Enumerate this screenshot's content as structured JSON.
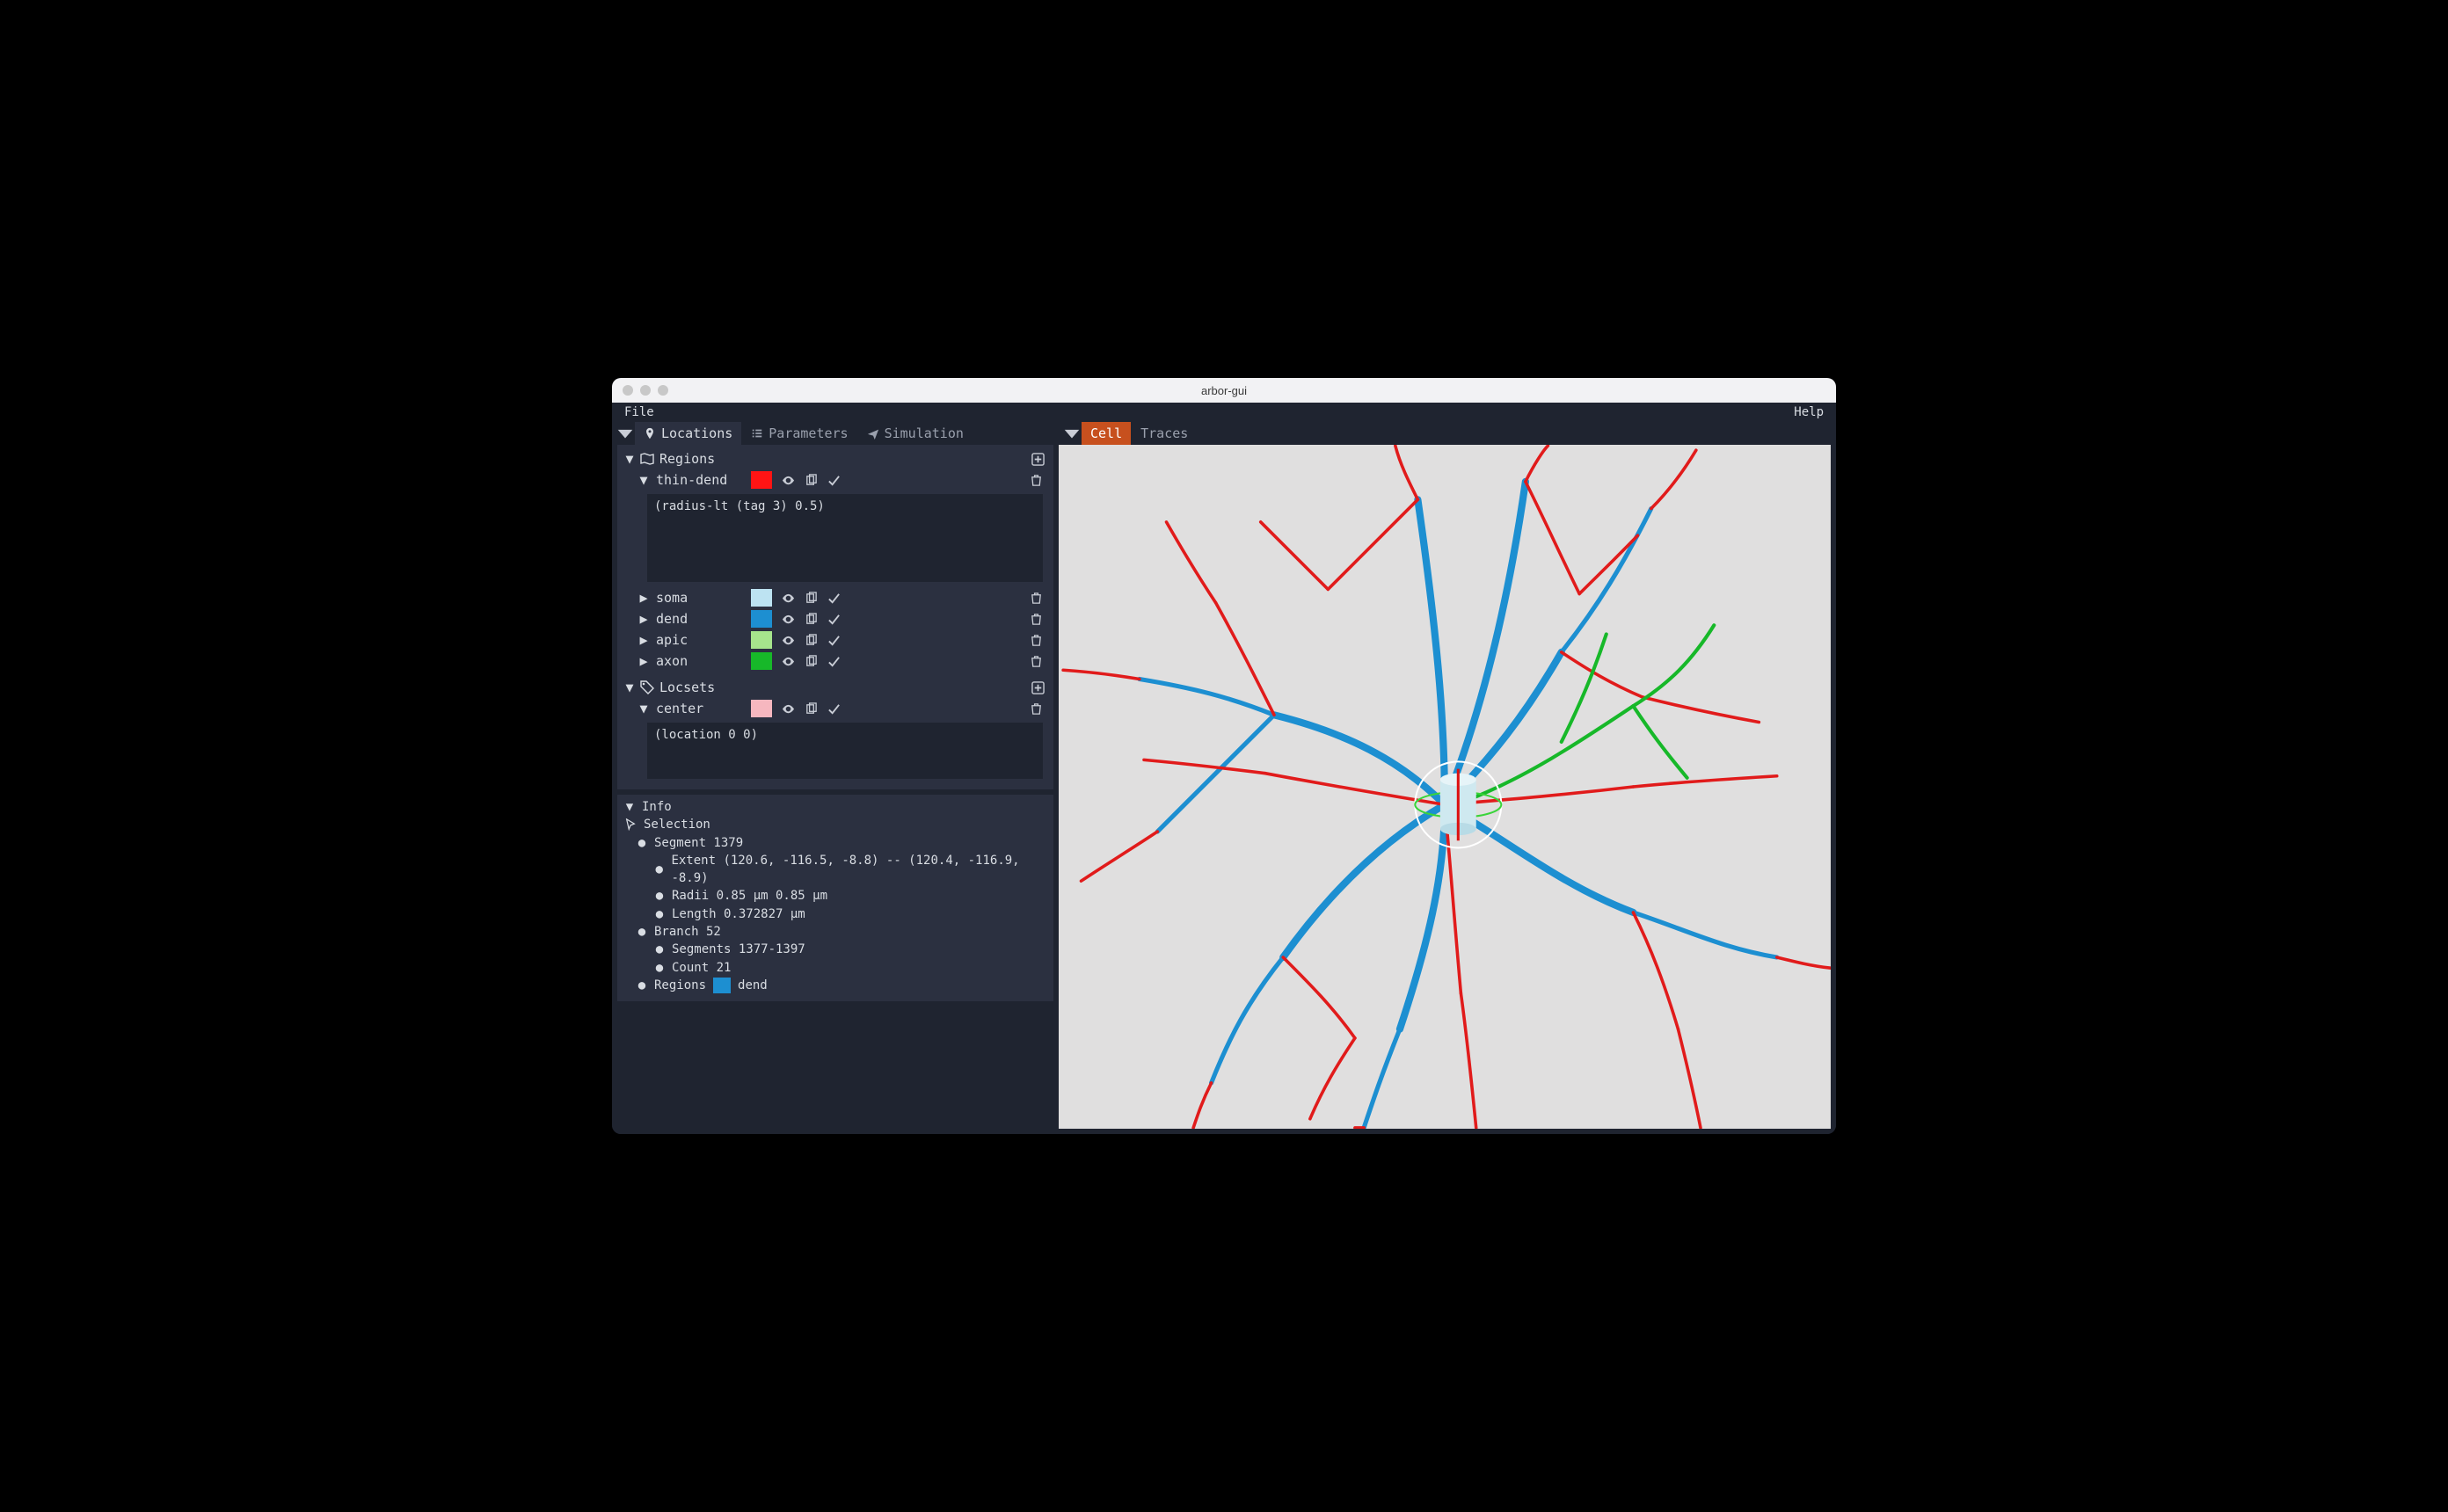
{
  "window": {
    "title": "arbor-gui"
  },
  "menubar": {
    "file": "File",
    "help": "Help"
  },
  "left_tabs": [
    {
      "id": "locations",
      "label": "Locations",
      "icon": "pin-icon"
    },
    {
      "id": "parameters",
      "label": "Parameters",
      "icon": "list-icon"
    },
    {
      "id": "simulation",
      "label": "Simulation",
      "icon": "plane-icon"
    }
  ],
  "right_tabs": [
    {
      "id": "cell",
      "label": "Cell",
      "active": true
    },
    {
      "id": "traces",
      "label": "Traces",
      "active": false
    }
  ],
  "regions": {
    "header": "Regions",
    "items": [
      {
        "name": "thin-dend",
        "color": "#ff1414",
        "expanded": true,
        "expr": "(radius-lt (tag 3) 0.5)"
      },
      {
        "name": "soma",
        "color": "#bde3f2",
        "expanded": false
      },
      {
        "name": "dend",
        "color": "#1d8fd1",
        "expanded": false
      },
      {
        "name": "apic",
        "color": "#a6e58c",
        "expanded": false
      },
      {
        "name": "axon",
        "color": "#17b829",
        "expanded": false
      }
    ]
  },
  "locsets": {
    "header": "Locsets",
    "items": [
      {
        "name": "center",
        "color": "#f6b7bf",
        "expanded": true,
        "expr": "(location 0 0)"
      }
    ]
  },
  "info": {
    "header": "Info",
    "selection_label": "Selection",
    "segment_label": "Segment 1379",
    "extent_label": "Extent (120.6, -116.5, -8.8) -- (120.4, -116.9, -8.9)",
    "radii_label": "Radii  0.85 µm 0.85 µm",
    "length_label": "Length 0.372827 µm",
    "branch_label": "Branch 52",
    "segments_label": "Segments 1377-1397",
    "count_label": "Count 21",
    "regions_label": "Regions",
    "regions_value": "dend",
    "regions_color": "#1d8fd1"
  }
}
